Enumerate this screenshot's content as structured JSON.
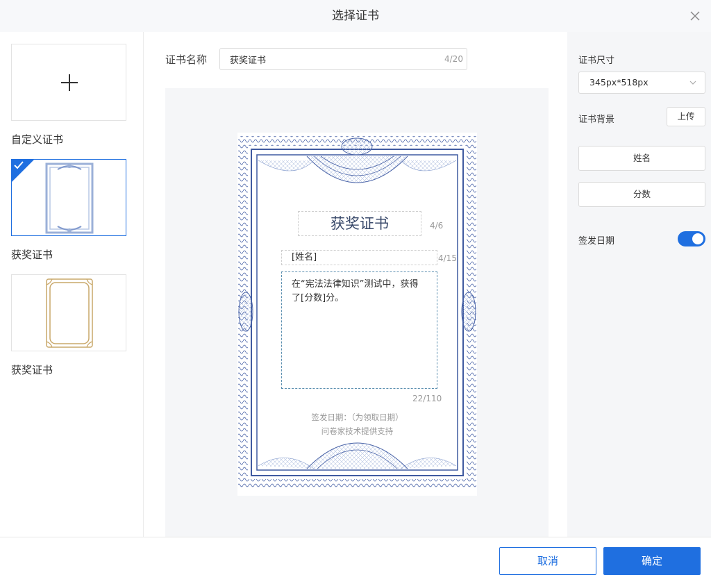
{
  "dialog": {
    "title": "选择证书"
  },
  "templates": [
    {
      "label": "自定义证书",
      "type": "custom"
    },
    {
      "label": "获奖证书",
      "type": "blue-border",
      "selected": true
    },
    {
      "label": "获奖证书",
      "type": "gold-border"
    }
  ],
  "name_field": {
    "label": "证书名称",
    "value": "获奖证书",
    "count": "4/20"
  },
  "certificate": {
    "title": "获奖证书",
    "title_count": "4/6",
    "name_placeholder": "[姓名]",
    "name_count": "4/15",
    "body": "在“宪法法律知识”测试中，获得了[分数]分。",
    "body_count": "22/110",
    "date_line": "签发日期：（为领取日期）",
    "support_line": "问卷家技术提供支持"
  },
  "settings": {
    "size_label": "证书尺寸",
    "size_value": "345px*518px",
    "background_label": "证书背景",
    "upload_label": "上传",
    "field_name": "姓名",
    "field_score": "分数",
    "issue_date_label": "签发日期",
    "issue_date_enabled": true
  },
  "footer": {
    "cancel_label": "取消",
    "ok_label": "确定"
  },
  "colors": {
    "accent": "#1f6fe0",
    "border_blue": "#4a64a8",
    "gold": "#c9a86a"
  }
}
